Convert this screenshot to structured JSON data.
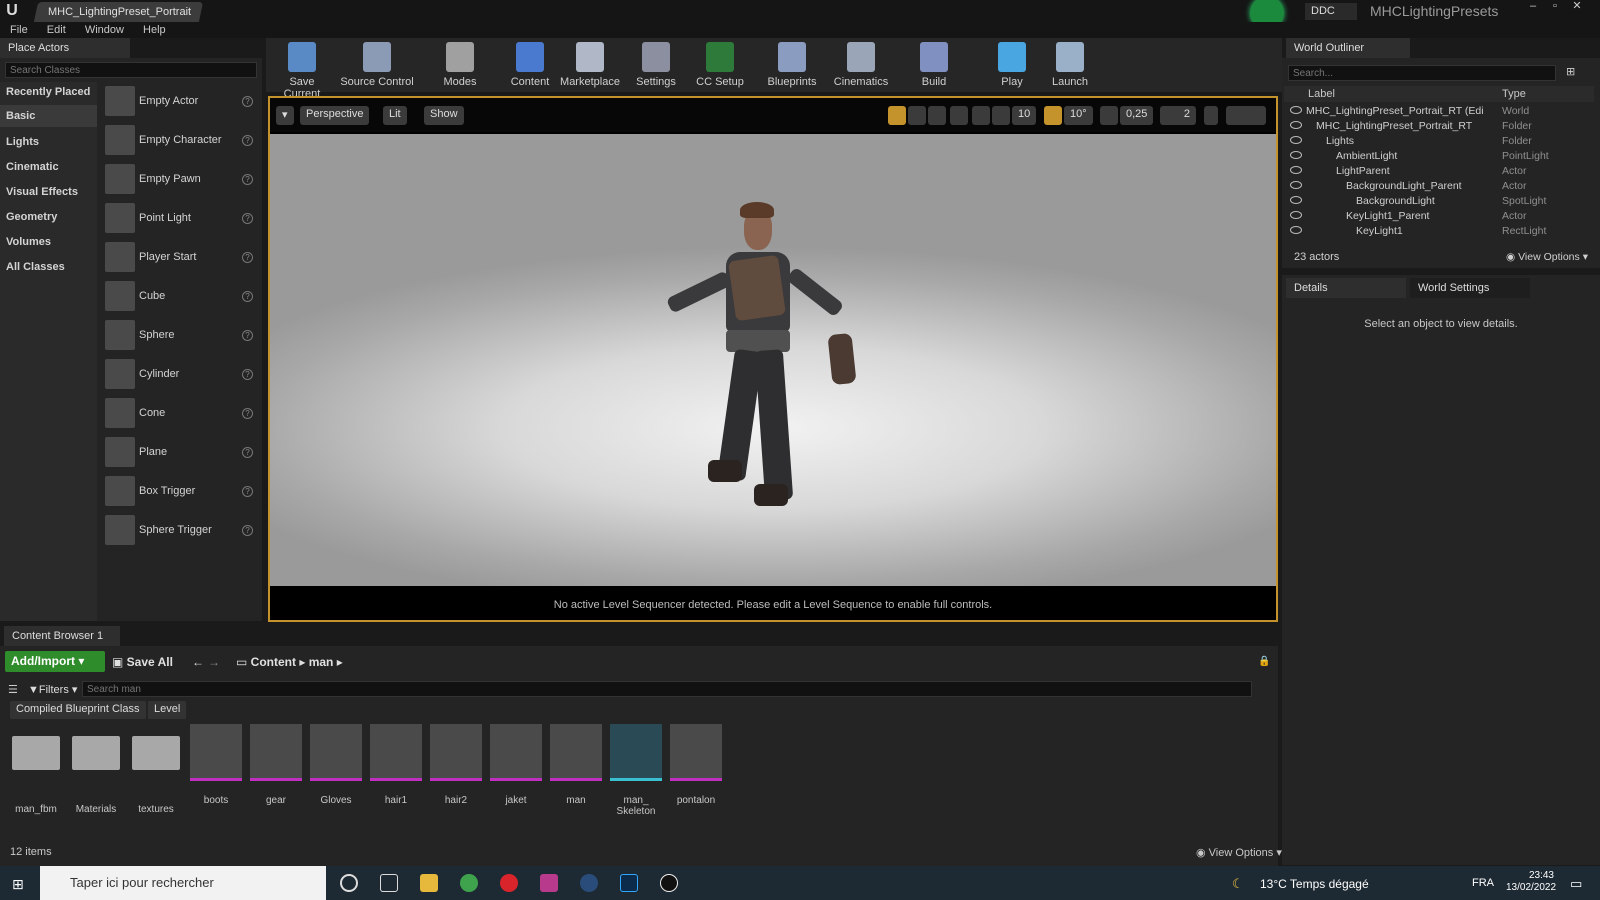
{
  "window": {
    "document_tab": "MHC_LightingPreset_Portrait",
    "ddc_label": "DDC",
    "project_name": "MHCLightingPresets"
  },
  "menu": [
    "File",
    "Edit",
    "Window",
    "Help"
  ],
  "place_actors": {
    "tab_label": "Place Actors",
    "search_placeholder": "Search Classes",
    "categories": [
      "Recently Placed",
      "Basic",
      "Lights",
      "Cinematic",
      "Visual Effects",
      "Geometry",
      "Volumes",
      "All Classes"
    ],
    "selected_category": "Basic",
    "actors": [
      "Empty Actor",
      "Empty Character",
      "Empty Pawn",
      "Point Light",
      "Player Start",
      "Cube",
      "Sphere",
      "Cylinder",
      "Cone",
      "Plane",
      "Box Trigger",
      "Sphere Trigger"
    ]
  },
  "toolbar": {
    "buttons": [
      "Save Current",
      "Source Control",
      "Modes",
      "Content",
      "Marketplace",
      "Settings",
      "CC Setup",
      "Blueprints",
      "Cinematics",
      "Build",
      "Play",
      "Launch"
    ]
  },
  "viewport": {
    "perspective": "Perspective",
    "lit": "Lit",
    "show": "Show",
    "grid_snap": "10",
    "rot_snap": "10°",
    "scale_snap": "0,25",
    "cam_speed": "2",
    "sequencer_message": "No active Level Sequencer detected. Please edit a Level Sequence to enable full controls."
  },
  "world_outliner": {
    "tab_label": "World Outliner",
    "search_placeholder": "Search...",
    "col_label": "Label",
    "col_type": "Type",
    "rows": [
      {
        "label": "MHC_LightingPreset_Portrait_RT (Edi",
        "type": "World",
        "indent": 0
      },
      {
        "label": "MHC_LightingPreset_Portrait_RT",
        "type": "Folder",
        "indent": 1
      },
      {
        "label": "Lights",
        "type": "Folder",
        "indent": 2
      },
      {
        "label": "AmbientLight",
        "type": "PointLight",
        "indent": 3
      },
      {
        "label": "LightParent",
        "type": "Actor",
        "indent": 3
      },
      {
        "label": "BackgroundLight_Parent",
        "type": "Actor",
        "indent": 4
      },
      {
        "label": "BackgroundLight",
        "type": "SpotLight",
        "indent": 5
      },
      {
        "label": "KeyLight1_Parent",
        "type": "Actor",
        "indent": 4
      },
      {
        "label": "KeyLight1",
        "type": "RectLight",
        "indent": 5
      }
    ],
    "actor_count": "23 actors",
    "view_options": "View Options"
  },
  "details": {
    "tab_label": "Details",
    "world_settings_label": "World Settings",
    "empty_message": "Select an object to view details."
  },
  "content_browser": {
    "tab_label": "Content Browser 1",
    "add_import": "Add/Import",
    "save_all": "Save All",
    "path_root": "Content",
    "path_folder": "man",
    "filters": "Filters",
    "search_placeholder": "Search man",
    "filter_chips": [
      "Compiled Blueprint Class",
      "Level"
    ],
    "assets": [
      {
        "name": "man_fbm",
        "kind": "folder"
      },
      {
        "name": "Materials",
        "kind": "folder"
      },
      {
        "name": "textures",
        "kind": "folder"
      },
      {
        "name": "boots",
        "kind": "mesh"
      },
      {
        "name": "gear",
        "kind": "mesh"
      },
      {
        "name": "Gloves",
        "kind": "mesh"
      },
      {
        "name": "hair1",
        "kind": "mesh"
      },
      {
        "name": "hair2",
        "kind": "mesh"
      },
      {
        "name": "jaket",
        "kind": "mesh"
      },
      {
        "name": "man",
        "kind": "mesh"
      },
      {
        "name": "man_ Skeleton",
        "kind": "skeleton"
      },
      {
        "name": "pontalon",
        "kind": "mesh"
      }
    ],
    "item_count": "12 items",
    "view_options": "View Options"
  },
  "taskbar": {
    "search_placeholder": "Taper ici pour rechercher",
    "weather": "13°C  Temps dégagé",
    "language": "FRA",
    "time": "23:43",
    "date": "13/02/2022"
  },
  "colors": {
    "accent_viewport_border": "#c5932b",
    "add_import_green": "#2e8c2a",
    "mesh_asset_bar": "#c030c0"
  }
}
